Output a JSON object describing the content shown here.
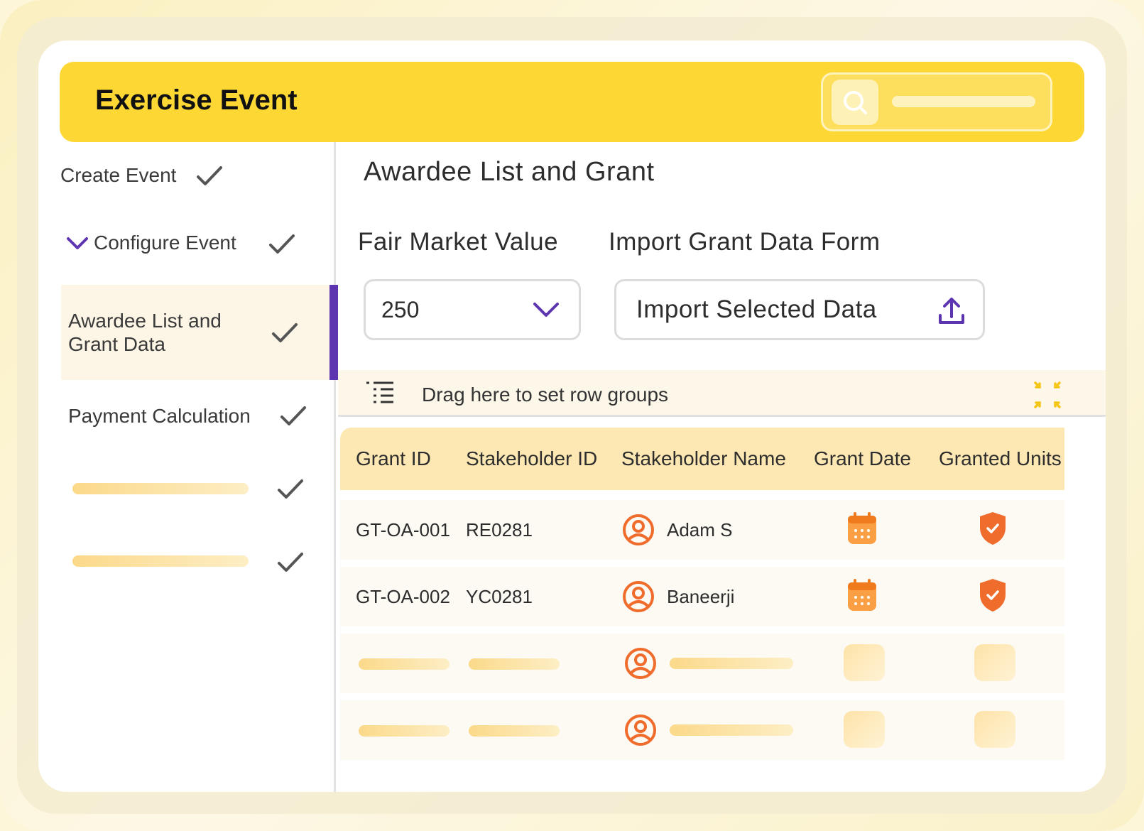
{
  "header": {
    "title": "Exercise Event",
    "search_icon": "search-icon"
  },
  "sidebar": {
    "items": [
      {
        "label": "Create Event",
        "status": "done"
      },
      {
        "label": "Configure Event",
        "status": "done",
        "expanded": true
      },
      {
        "label": "Awardee List and Grant Data",
        "line1": "Awardee List and",
        "line2": "Grant Data",
        "status": "done",
        "active": true
      },
      {
        "label": "Payment Calculation",
        "status": "done"
      },
      {
        "label": "",
        "status": "done",
        "placeholder": true
      },
      {
        "label": "",
        "status": "done",
        "placeholder": true
      }
    ]
  },
  "main": {
    "title": "Awardee List and Grant",
    "fair_market_value": {
      "label": "Fair Market Value",
      "value": "250"
    },
    "import_form": {
      "label": "Import Grant Data Form",
      "button_label": "Import Selected Data"
    },
    "group_bar": {
      "text": "Drag here to set row groups"
    },
    "table": {
      "columns": [
        "Grant ID",
        "Stakeholder ID",
        "Stakeholder Name",
        "Grant Date",
        "Granted Units"
      ],
      "rows": [
        {
          "grant_id": "GT-OA-001",
          "stakeholder_id": "RE0281",
          "name": "Adam S"
        },
        {
          "grant_id": "GT-OA-002",
          "stakeholder_id": "YC0281",
          "name": "Baneerji"
        }
      ],
      "placeholder_rows": 2
    }
  },
  "colors": {
    "header_bg": "#fdd835",
    "accent_purple": "#5e35b1",
    "icon_orange": "#ef6c2c",
    "table_header_bg": "#fde7b3"
  }
}
